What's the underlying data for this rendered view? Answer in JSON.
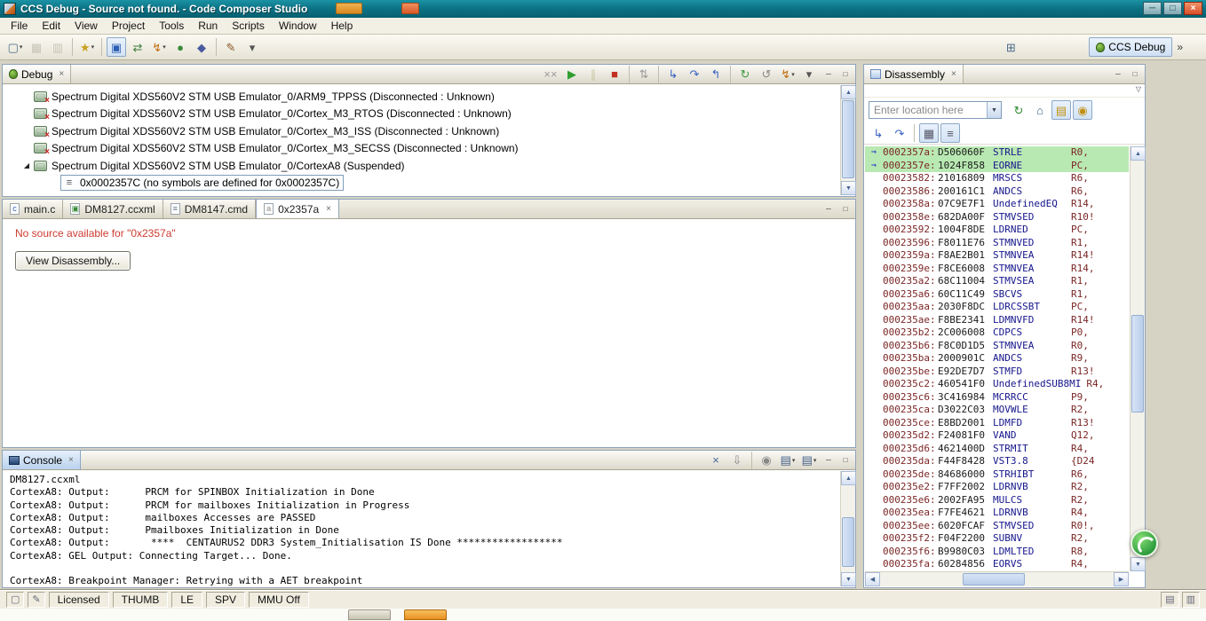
{
  "colors": {
    "titlebar": "#0d7486",
    "pc_highlight": "#b9e9b2",
    "error_text": "#cc3b2f",
    "address_text": "#7b2626",
    "mnemonic_text": "#16168c"
  },
  "window": {
    "title": "CCS Debug - Source not found. - Code Composer Studio",
    "controls": {
      "minimize": "─",
      "maximize": "□",
      "close": "×"
    }
  },
  "panel_controls": {
    "minimize": "─",
    "maximize": "□"
  },
  "menubar": {
    "items": [
      "File",
      "Edit",
      "View",
      "Project",
      "Tools",
      "Run",
      "Scripts",
      "Window",
      "Help"
    ]
  },
  "toolbar": {
    "buttons": [
      {
        "name": "new-button",
        "glyph": "▢",
        "color": "#4a6a8a",
        "dropdown": true
      },
      {
        "name": "save-button",
        "glyph": "▦",
        "color": "#8a8a7a",
        "disabled": true
      },
      {
        "name": "save-all-button",
        "glyph": "▥",
        "color": "#8a8a7a",
        "disabled": true
      },
      {
        "sep": true
      },
      {
        "name": "new-wizard-button",
        "glyph": "★",
        "color": "#c8a020",
        "dropdown": true
      },
      {
        "sep": true
      },
      {
        "name": "target-config-button",
        "glyph": "▣",
        "color": "#2b5fb4",
        "pressed": true
      },
      {
        "name": "connect-target-button",
        "glyph": "⇄",
        "color": "#3a7a3a"
      },
      {
        "name": "flash-button",
        "glyph": "↯",
        "color": "#c06a10",
        "dropdown": true
      },
      {
        "name": "debug-launch-button",
        "glyph": "●",
        "color": "#3a8a3a"
      },
      {
        "name": "breakpoint-button",
        "glyph": "◆",
        "color": "#4a5aa0"
      },
      {
        "sep": true
      },
      {
        "name": "trace-button",
        "glyph": "✎",
        "color": "#8a5a2a"
      },
      {
        "name": "more-toolbar-button",
        "glyph": "▾",
        "color": "#555555"
      }
    ],
    "perspective": {
      "open_glyph": "⊞",
      "label": "CCS Debug",
      "more": "»"
    }
  },
  "debug_view": {
    "tab_label": "Debug",
    "toolbar": [
      {
        "name": "remove-terminated-button",
        "glyph": "××",
        "color": "#9a9a9a"
      },
      {
        "name": "resume-button",
        "glyph": "▶",
        "color": "#2f9e2f"
      },
      {
        "name": "suspend-button",
        "glyph": "∥",
        "color": "#9a9a44",
        "disabled": true
      },
      {
        "name": "terminate-button",
        "glyph": "■",
        "color": "#c23020"
      },
      {
        "sep": true
      },
      {
        "name": "disconnect-button",
        "glyph": "⇅",
        "color": "#9a9a9a"
      },
      {
        "sep": true
      },
      {
        "name": "step-into-button",
        "glyph": "↳",
        "color": "#3a62c4"
      },
      {
        "name": "step-over-button",
        "glyph": "↷",
        "color": "#3a62c4"
      },
      {
        "name": "step-return-button",
        "glyph": "↰",
        "color": "#3a62c4"
      },
      {
        "sep": true
      },
      {
        "name": "restart-button",
        "glyph": "↻",
        "color": "#3a9a3a"
      },
      {
        "name": "refresh-button",
        "glyph": "↺",
        "color": "#888888"
      },
      {
        "name": "flash-actions-button",
        "glyph": "↯",
        "color": "#c06a10",
        "dropdown": true
      },
      {
        "name": "debug-more-button",
        "glyph": "▾",
        "color": "#555555"
      }
    ],
    "tree": [
      {
        "label": "Spectrum Digital XDS560V2 STM USB Emulator_0/ARM9_TPPSS (Disconnected : Unknown)",
        "state": "disconnected"
      },
      {
        "label": "Spectrum Digital XDS560V2 STM USB Emulator_0/Cortex_M3_RTOS (Disconnected : Unknown)",
        "state": "disconnected"
      },
      {
        "label": "Spectrum Digital XDS560V2 STM USB Emulator_0/Cortex_M3_ISS (Disconnected : Unknown)",
        "state": "disconnected"
      },
      {
        "label": "Spectrum Digital XDS560V2 STM USB Emulator_0/Cortex_M3_SECSS (Disconnected : Unknown)",
        "state": "disconnected"
      },
      {
        "label": "Spectrum Digital XDS560V2 STM USB Emulator_0/CortexA8 (Suspended)",
        "state": "suspended",
        "expanded": true
      },
      {
        "label": "0x0002357C (no symbols are defined for 0x0002357C)",
        "state": "frame",
        "selected": true,
        "child": true
      }
    ]
  },
  "editor": {
    "tabs": [
      {
        "label": "main.c",
        "icon": "c-file-icon",
        "icon_char": "c",
        "icon_color": "#2b5fb4"
      },
      {
        "label": "DM8127.ccxml",
        "icon": "ccxml-file-icon",
        "icon_char": "▣",
        "icon_color": "#3a8a3a"
      },
      {
        "label": "DM8147.cmd",
        "icon": "cmd-file-icon",
        "icon_char": "≡",
        "icon_color": "#667788"
      },
      {
        "label": "0x2357a",
        "icon": "source-file-icon",
        "icon_char": "a",
        "icon_color": "#888888",
        "active": true,
        "closable": true
      }
    ],
    "message": "No source available for \"0x2357a\"",
    "button_label": "View Disassembly..."
  },
  "console": {
    "tab_label": "Console",
    "toolbar": [
      {
        "name": "clear-console-button",
        "glyph": "×",
        "color": "#4a6a9a"
      },
      {
        "name": "scroll-lock-button",
        "glyph": "⇩",
        "color": "#888888"
      },
      {
        "sep": true
      },
      {
        "name": "pin-console-button",
        "glyph": "◉",
        "color": "#888888"
      },
      {
        "name": "display-console-button",
        "glyph": "▤",
        "color": "#44608a",
        "dropdown": true
      },
      {
        "name": "open-console-button",
        "glyph": "▤",
        "color": "#44608a",
        "dropdown": true
      }
    ],
    "lines": [
      "DM8127.ccxml",
      "CortexA8: Output:      PRCM for SPINBOX Initialization in Done",
      "CortexA8: Output:      PRCM for mailboxes Initialization in Progress",
      "CortexA8: Output:      mailboxes Accesses are PASSED",
      "CortexA8: Output:      Pmailboxes Initialization in Done",
      "CortexA8: Output:       ****  CENTAURUS2 DDR3 System_Initialisation IS Done ******************",
      "CortexA8: GEL Output: Connecting Target... Done.",
      "",
      "CortexA8: Breakpoint Manager: Retrying with a AET breakpoint"
    ]
  },
  "disassembly": {
    "tab_label": "Disassembly",
    "location_placeholder": "Enter location here",
    "location_toolbar": [
      {
        "name": "navigate-button",
        "glyph": "↻",
        "color": "#2f8a2f"
      },
      {
        "name": "home-button",
        "glyph": "⌂",
        "color": "#44608a"
      },
      {
        "name": "refresh-view-button",
        "glyph": "▤",
        "color": "#c49010",
        "pressed": true
      },
      {
        "name": "lock-pc-button",
        "glyph": "◉",
        "color": "#c49010",
        "pressed": true
      }
    ],
    "toolbar": [
      {
        "name": "asm-step-into-button",
        "glyph": "↳",
        "color": "#3a62c4"
      },
      {
        "name": "asm-step-over-button",
        "glyph": "↷",
        "color": "#3a62c4"
      },
      {
        "sep": true
      },
      {
        "name": "show-opcodes-button",
        "glyph": "▦",
        "color": "#555566",
        "pressed": true
      },
      {
        "name": "show-addresses-button",
        "glyph": "≡",
        "color": "#555566",
        "pressed": true
      }
    ],
    "rows": [
      {
        "addr": "0002357a:",
        "opcode": "D506060F",
        "mn": "STRLE",
        "op": "R0,",
        "pc": true
      },
      {
        "addr": "0002357e:",
        "opcode": "1024F858",
        "mn": "EORNE",
        "op": "PC,",
        "pc": true
      },
      {
        "addr": "00023582:",
        "opcode": "21016809",
        "mn": "MRSCS",
        "op": "R6,"
      },
      {
        "addr": "00023586:",
        "opcode": "200161C1",
        "mn": "ANDCS",
        "op": "R6,"
      },
      {
        "addr": "0002358a:",
        "opcode": "07C9E7F1",
        "mn": "UndefinedEQ",
        "op": "R14,"
      },
      {
        "addr": "0002358e:",
        "opcode": "682DA00F",
        "mn": "STMVSED",
        "op": "R10!"
      },
      {
        "addr": "00023592:",
        "opcode": "1004F8DE",
        "mn": "LDRNED",
        "op": "PC,"
      },
      {
        "addr": "00023596:",
        "opcode": "F8011E76",
        "mn": "STMNVED",
        "op": "R1,"
      },
      {
        "addr": "0002359a:",
        "opcode": "F8AE2B01",
        "mn": "STMNVEA",
        "op": "R14!"
      },
      {
        "addr": "0002359e:",
        "opcode": "F8CE6008",
        "mn": "STMNVEA",
        "op": "R14,"
      },
      {
        "addr": "000235a2:",
        "opcode": "68C11004",
        "mn": "STMVSEA",
        "op": "R1,"
      },
      {
        "addr": "000235a6:",
        "opcode": "60C11C49",
        "mn": "SBCVS",
        "op": "R1,"
      },
      {
        "addr": "000235aa:",
        "opcode": "2030F8DC",
        "mn": "LDRCSSBT",
        "op": "PC,"
      },
      {
        "addr": "000235ae:",
        "opcode": "F8BE2341",
        "mn": "LDMNVFD",
        "op": "R14!"
      },
      {
        "addr": "000235b2:",
        "opcode": "2C006008",
        "mn": "CDPCS",
        "op": "P0,"
      },
      {
        "addr": "000235b6:",
        "opcode": "F8C0D1D5",
        "mn": "STMNVEA",
        "op": "R0,"
      },
      {
        "addr": "000235ba:",
        "opcode": "2000901C",
        "mn": "ANDCS",
        "op": "R9,"
      },
      {
        "addr": "000235be:",
        "opcode": "E92DE7D7",
        "mn": "STMFD",
        "op": "R13!"
      },
      {
        "addr": "000235c2:",
        "opcode": "460541F0",
        "mn": "UndefinedSUB8MI",
        "op": "R4,"
      },
      {
        "addr": "000235c6:",
        "opcode": "3C416984",
        "mn": "MCRRCC",
        "op": "P9,"
      },
      {
        "addr": "000235ca:",
        "opcode": "D3022C03",
        "mn": "MOVWLE",
        "op": "R2,"
      },
      {
        "addr": "000235ce:",
        "opcode": "E8BD2001",
        "mn": "LDMFD",
        "op": "R13!"
      },
      {
        "addr": "000235d2:",
        "opcode": "F24081F0",
        "mn": "VAND",
        "op": "Q12,"
      },
      {
        "addr": "000235d6:",
        "opcode": "4621400D",
        "mn": "STRMIT",
        "op": "R4,"
      },
      {
        "addr": "000235da:",
        "opcode": "F44F8428",
        "mn": "VST3.8",
        "op": "{D24"
      },
      {
        "addr": "000235de:",
        "opcode": "84686000",
        "mn": "STRHIBT",
        "op": "R6,"
      },
      {
        "addr": "000235e2:",
        "opcode": "F7FF2002",
        "mn": "LDRNVB",
        "op": "R2,"
      },
      {
        "addr": "000235e6:",
        "opcode": "2002FA95",
        "mn": "MULCS",
        "op": "R2,"
      },
      {
        "addr": "000235ea:",
        "opcode": "F7FE4621",
        "mn": "LDRNVB",
        "op": "R4,"
      },
      {
        "addr": "000235ee:",
        "opcode": "6020FCAF",
        "mn": "STMVSED",
        "op": "R0!,"
      },
      {
        "addr": "000235f2:",
        "opcode": "F04F2200",
        "mn": "SUBNV",
        "op": "R2,"
      },
      {
        "addr": "000235f6:",
        "opcode": "B9980C03",
        "mn": "LDMLTED",
        "op": "R8,"
      },
      {
        "addr": "000235fa:",
        "opcode": "60284856",
        "mn": "EORVS",
        "op": "R4,"
      }
    ]
  },
  "statusbar": {
    "left_icons": [
      {
        "name": "editor-state-icon",
        "glyph": "▢"
      },
      {
        "name": "edit-mode-icon",
        "glyph": "✎"
      }
    ],
    "cells": [
      "Licensed",
      "THUMB",
      "LE",
      "SPV",
      "MMU Off"
    ],
    "right_icons": [
      {
        "name": "print-status-icon",
        "glyph": "▤"
      },
      {
        "name": "view-status-icon",
        "glyph": "▥"
      }
    ]
  }
}
